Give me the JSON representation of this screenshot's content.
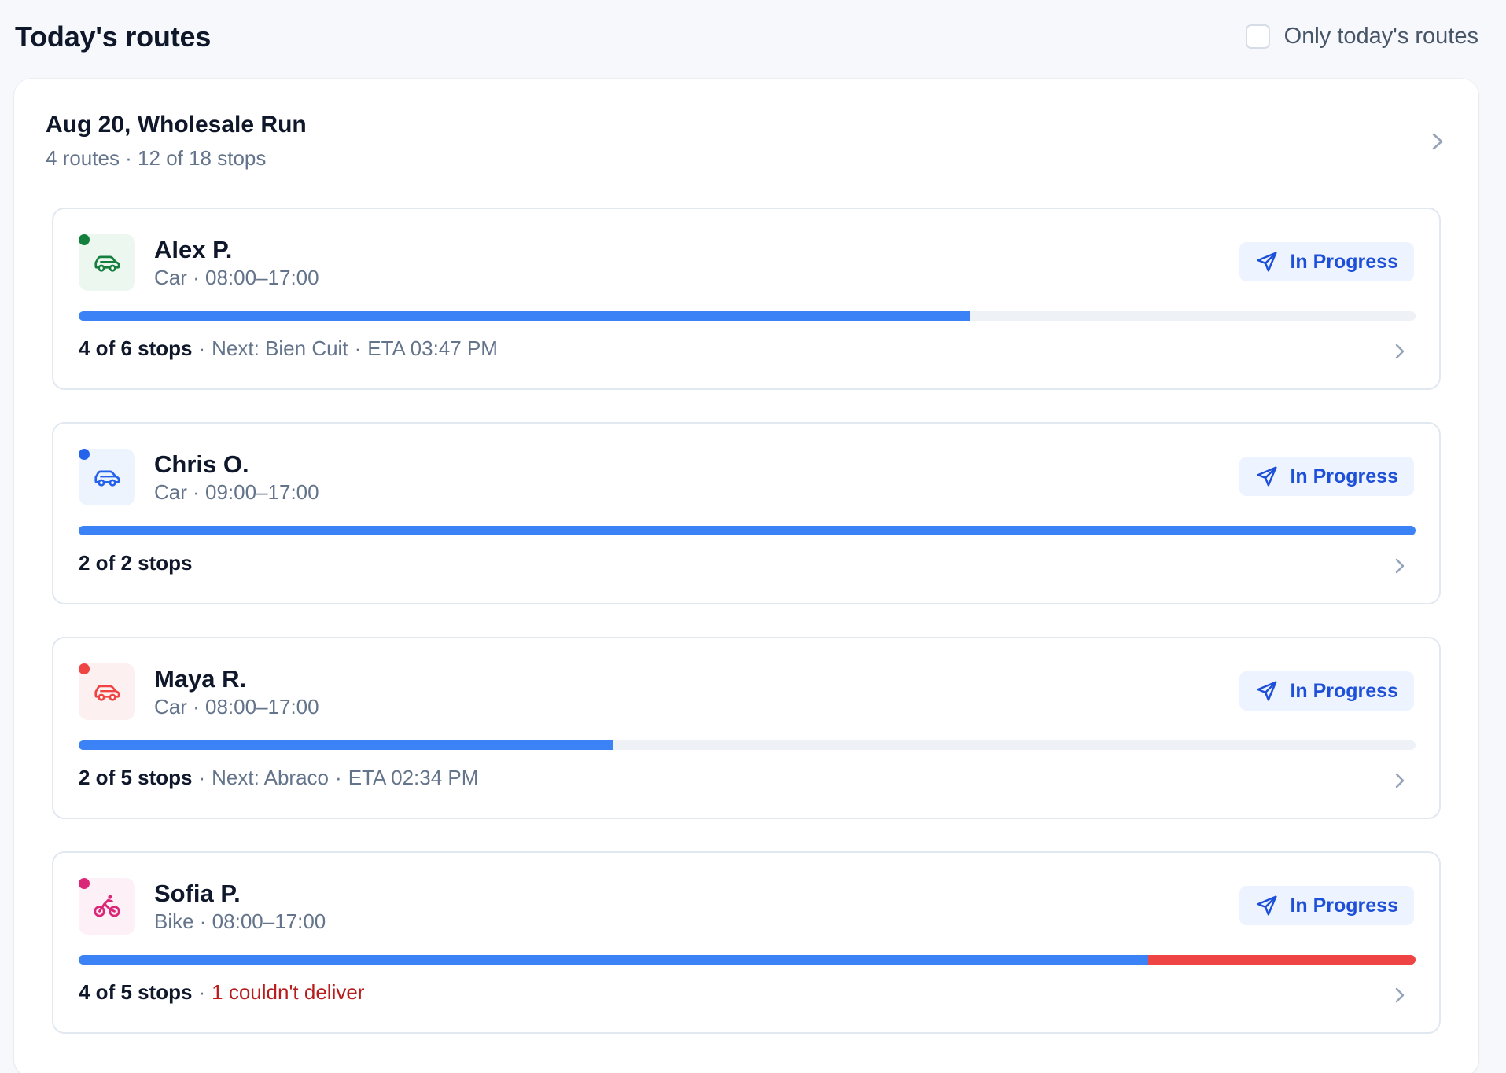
{
  "header": {
    "title": "Today's routes",
    "filter_label": "Only today's routes",
    "filter_checked": false
  },
  "group": {
    "title": "Aug 20, Wholesale Run",
    "subtitle": "4 routes · 12 of 18 stops"
  },
  "colors": {
    "progress_done": "#3b82f6",
    "progress_failed": "#ef4444",
    "badge_text": "#1d4fd8",
    "badge_bg": "#eef4ff"
  },
  "routes": [
    {
      "driver": "Alex P.",
      "meta": "Car · 08:00–17:00",
      "vehicle_icon": "car-icon",
      "accent": "#15803d",
      "accent_bg": "#ecf7ef",
      "status": "In Progress",
      "stops_text": "4 of 6 stops",
      "completed": 4,
      "failed": 0,
      "total": 6,
      "next_text": "Next: Bien Cuit",
      "eta_text": "ETA 03:47 PM",
      "fail_text": ""
    },
    {
      "driver": "Chris O.",
      "meta": "Car · 09:00–17:00",
      "vehicle_icon": "car-icon",
      "accent": "#2563eb",
      "accent_bg": "#eef4fd",
      "status": "In Progress",
      "stops_text": "2 of 2 stops",
      "completed": 2,
      "failed": 0,
      "total": 2,
      "next_text": "",
      "eta_text": "",
      "fail_text": ""
    },
    {
      "driver": "Maya R.",
      "meta": "Car · 08:00–17:00",
      "vehicle_icon": "car-icon",
      "accent": "#ef4444",
      "accent_bg": "#fdf0f0",
      "status": "In Progress",
      "stops_text": "2 of 5 stops",
      "completed": 2,
      "failed": 0,
      "total": 5,
      "next_text": "Next: Abraco",
      "eta_text": "ETA 02:34 PM",
      "fail_text": ""
    },
    {
      "driver": "Sofia P.",
      "meta": "Bike · 08:00–17:00",
      "vehicle_icon": "bike-icon",
      "accent": "#db2777",
      "accent_bg": "#fdf0f6",
      "status": "In Progress",
      "stops_text": "4 of 5 stops",
      "completed": 4,
      "failed": 1,
      "total": 5,
      "next_text": "",
      "eta_text": "",
      "fail_text": "1 couldn't deliver"
    }
  ]
}
